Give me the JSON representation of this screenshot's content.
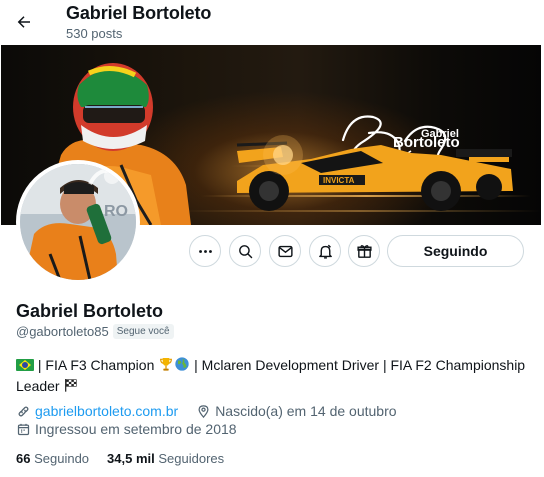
{
  "topbar": {
    "name": "Gabriel Bortoleto",
    "posts": "530 posts",
    "back_icon": "arrow-left-icon"
  },
  "banner": {
    "signature_text": "Gabriel Bortoleto",
    "car_sponsor": "INVICTA"
  },
  "actions": {
    "icons": [
      "more-icon",
      "search-icon",
      "message-icon",
      "notification-bell-icon",
      "gift-icon"
    ],
    "follow_label": "Seguindo"
  },
  "profile": {
    "display_name": "Gabriel Bortoleto",
    "handle": "@gabortoleto85",
    "follows_you": "Segue você",
    "bio_prefix": " | FIA F3 Champion ",
    "bio_suffix": " | Mclaren Development Driver | FIA F2 Championship Leader ",
    "website": "gabrielbortoleto.com.br",
    "birthday": "Nascido(a) em 14 de outubro",
    "joined": "Ingressou em setembro de 2018"
  },
  "stats": {
    "following_count": "66",
    "following_label": "Seguindo",
    "followers_count": "34,5 mil",
    "followers_label": "Seguidores"
  },
  "colors": {
    "accent": "#1d9bf0",
    "secondary_text": "#536471",
    "border": "#cfd9de",
    "mclaren_orange": "#f28a14"
  }
}
